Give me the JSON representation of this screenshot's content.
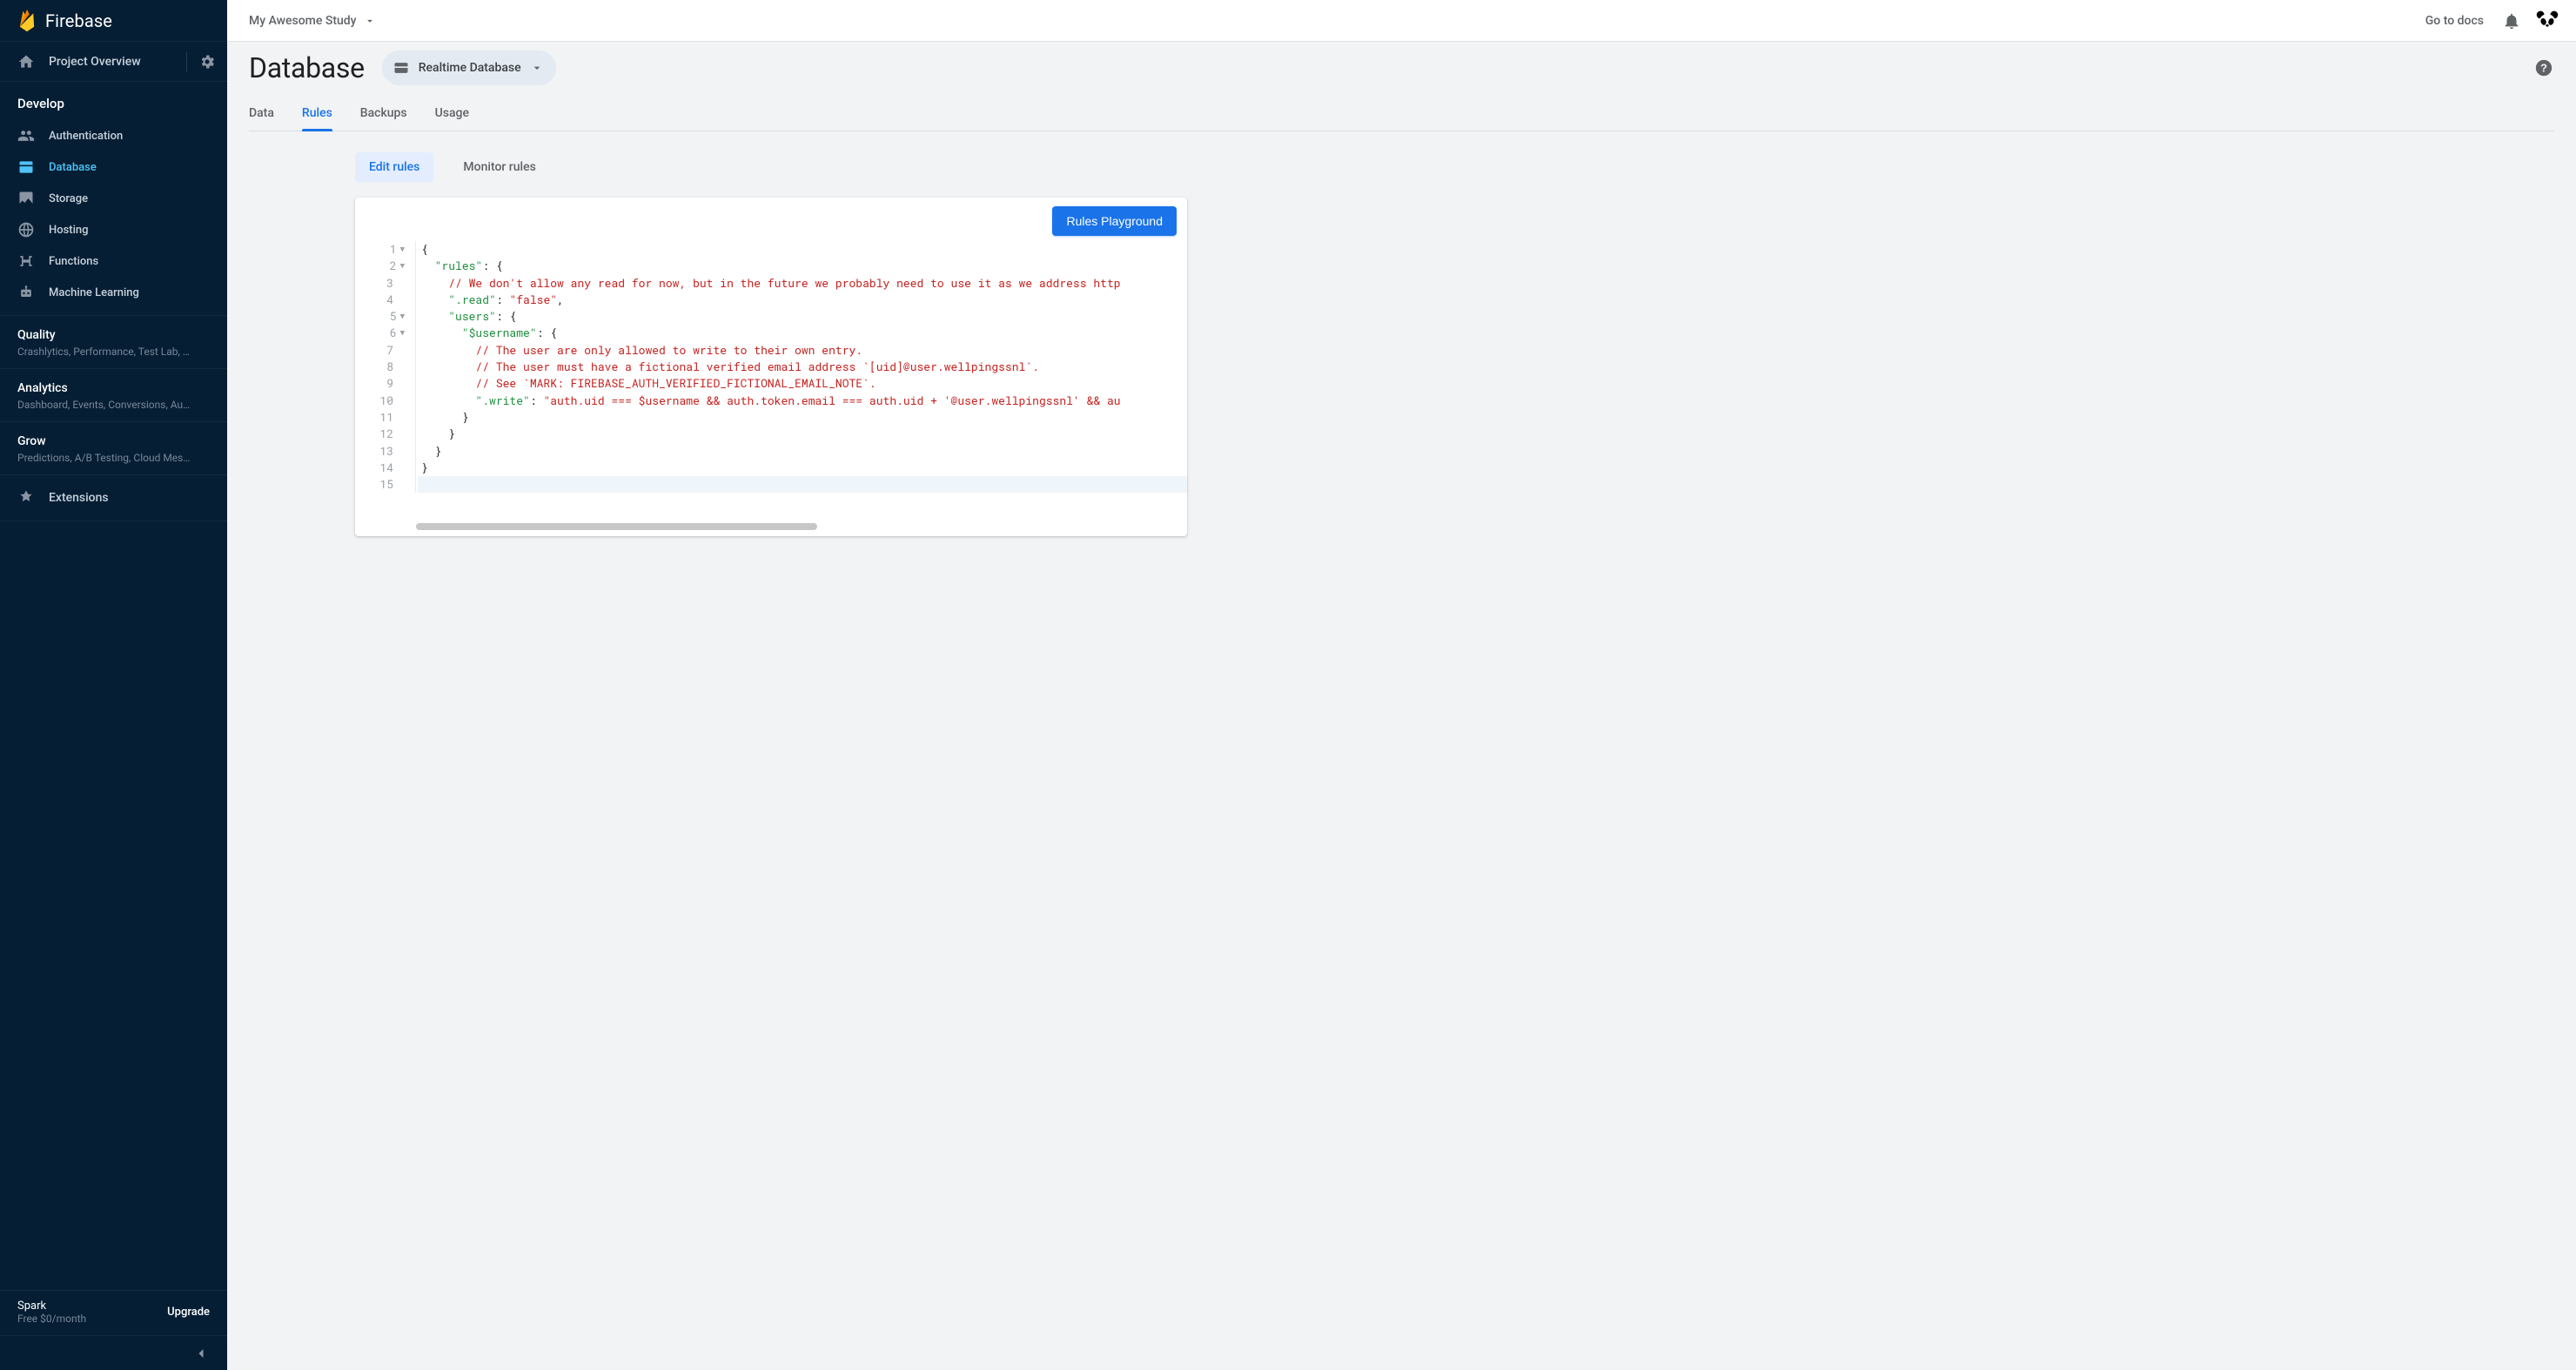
{
  "brand": {
    "name": "Firebase"
  },
  "sidebar": {
    "overview": "Project Overview",
    "develop": "Develop",
    "items": [
      {
        "label": "Authentication"
      },
      {
        "label": "Database"
      },
      {
        "label": "Storage"
      },
      {
        "label": "Hosting"
      },
      {
        "label": "Functions"
      },
      {
        "label": "Machine Learning"
      }
    ],
    "quality": {
      "title": "Quality",
      "sub": "Crashlytics, Performance, Test Lab, …"
    },
    "analytics": {
      "title": "Analytics",
      "sub": "Dashboard, Events, Conversions, Au…"
    },
    "grow": {
      "title": "Grow",
      "sub": "Predictions, A/B Testing, Cloud Mes…"
    },
    "extensions": "Extensions",
    "plan": {
      "name": "Spark",
      "price": "Free $0/month",
      "upgrade": "Upgrade"
    }
  },
  "topbar": {
    "project": "My Awesome Study",
    "docs": "Go to docs"
  },
  "page": {
    "title": "Database",
    "chip": "Realtime Database",
    "tabs": [
      "Data",
      "Rules",
      "Backups",
      "Usage"
    ],
    "subtabs": [
      "Edit rules",
      "Monitor rules"
    ],
    "playground": "Rules Playground"
  },
  "editor": {
    "lines": [
      {
        "n": 1,
        "fold": true,
        "html": "<span class='tok-brace'>{</span>"
      },
      {
        "n": 2,
        "fold": true,
        "html": "  <span class='tok-key'>\"rules\"</span><span class='tok-punct'>: </span><span class='tok-brace'>{</span>"
      },
      {
        "n": 3,
        "fold": false,
        "html": "    <span class='tok-comment'>// We don't allow any read for now, but in the future we probably need to use it as we address http</span>"
      },
      {
        "n": 4,
        "fold": false,
        "html": "    <span class='tok-key'>\".read\"</span><span class='tok-punct'>: </span><span class='tok-str'>\"false\"</span><span class='tok-punct'>,</span>"
      },
      {
        "n": 5,
        "fold": true,
        "html": "    <span class='tok-key'>\"users\"</span><span class='tok-punct'>: </span><span class='tok-brace'>{</span>"
      },
      {
        "n": 6,
        "fold": true,
        "html": "      <span class='tok-key'>\"$username\"</span><span class='tok-punct'>: </span><span class='tok-brace'>{</span>"
      },
      {
        "n": 7,
        "fold": false,
        "html": "        <span class='tok-comment'>// The user are only allowed to write to their own entry.</span>"
      },
      {
        "n": 8,
        "fold": false,
        "html": "        <span class='tok-comment'>// The user must have a fictional verified email address `[uid]@user.wellpingssnl`.</span>"
      },
      {
        "n": 9,
        "fold": false,
        "html": "        <span class='tok-comment'>// See `MARK: FIREBASE_AUTH_VERIFIED_FICTIONAL_EMAIL_NOTE`.</span>"
      },
      {
        "n": 10,
        "fold": false,
        "html": "        <span class='tok-key'>\".write\"</span><span class='tok-punct'>: </span><span class='tok-str'>\"auth.uid === $username && auth.token.email === auth.uid + '@user.wellpingssnl' && au</span>"
      },
      {
        "n": 11,
        "fold": false,
        "html": "      <span class='tok-brace'>}</span>"
      },
      {
        "n": 12,
        "fold": false,
        "html": "    <span class='tok-brace'>}</span>"
      },
      {
        "n": 13,
        "fold": false,
        "html": "  <span class='tok-brace'>}</span>"
      },
      {
        "n": 14,
        "fold": false,
        "html": "<span class='tok-brace'>}</span>"
      },
      {
        "n": 15,
        "fold": false,
        "html": "",
        "cursor": true
      }
    ]
  }
}
